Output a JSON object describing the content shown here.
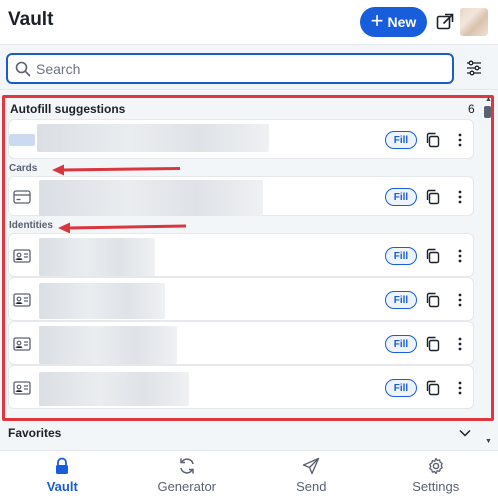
{
  "header": {
    "title": "Vault",
    "new_label": "New"
  },
  "search": {
    "placeholder": "Search"
  },
  "autofill": {
    "title": "Autofill suggestions",
    "count": "6"
  },
  "groups": {
    "cards": "Cards",
    "identities": "Identities"
  },
  "fill_label": "Fill",
  "favorites": {
    "title": "Favorites"
  },
  "nav": {
    "vault": "Vault",
    "generator": "Generator",
    "send": "Send",
    "settings": "Settings"
  },
  "colors": {
    "accent": "#175ddc",
    "highlight": "#e0363d",
    "arrow": "#d9363e"
  },
  "icons": {
    "new": "plus-icon",
    "popout": "popout-icon",
    "search": "search-icon",
    "filter": "filter-icon",
    "card": "card-icon",
    "identity": "id-card-icon",
    "copy": "copy-icon",
    "more": "more-vertical-icon",
    "chevron": "chevron-down-icon"
  }
}
